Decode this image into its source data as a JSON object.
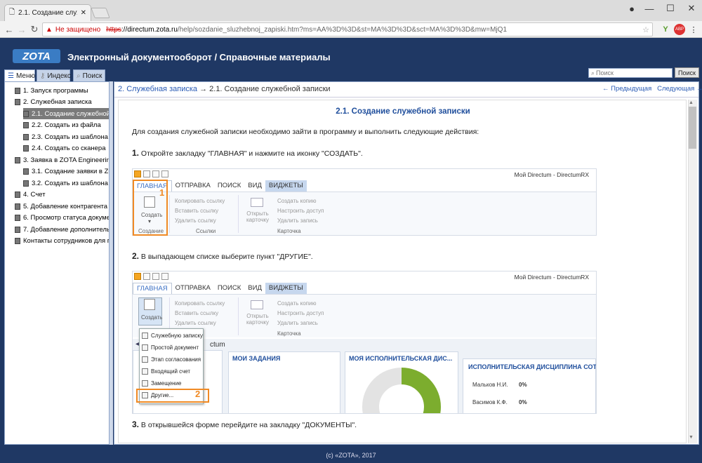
{
  "browser": {
    "tab_title": "2.1. Создание служебно",
    "not_secure": "Не защищено",
    "url_scheme": "https",
    "url_rest": "://directum.zota.ru",
    "url_path": "/help/sozdanie_sluzhebnoj_zapiski.htm?ms=AA%3D%3D&st=MA%3D%3D&sct=MA%3D%3D&mw=MjQ1"
  },
  "site": {
    "logo": "ZOTA",
    "title": "Электронный документооборот / Справочные материалы"
  },
  "left_tabs": [
    {
      "label": "Меню",
      "icon": "list-icon"
    },
    {
      "label": "Индекс",
      "icon": "key-icon"
    },
    {
      "label": "Поиск",
      "icon": "search-icon"
    }
  ],
  "search": {
    "placeholder": "Поиск",
    "button": "Поиск"
  },
  "tree": [
    {
      "label": "1. Запуск программы",
      "level": 0
    },
    {
      "label": "2. Служебная записка",
      "level": 0
    },
    {
      "label": "2.1. Создание служебной за",
      "level": 1,
      "selected": true
    },
    {
      "label": "2.2. Создать из файла",
      "level": 1
    },
    {
      "label": "2.3. Создать из шаблона",
      "level": 1
    },
    {
      "label": "2.4. Создать со сканера",
      "level": 1
    },
    {
      "label": "3. Заявка в ZOTA Engineering",
      "level": 0
    },
    {
      "label": "3.1. Создание заявки в ZOT",
      "level": 1
    },
    {
      "label": "3.2. Создать из шаблона",
      "level": 1
    },
    {
      "label": "4. Счет",
      "level": 0
    },
    {
      "label": "5. Добавление контрагента",
      "level": 0
    },
    {
      "label": "6. Просмотр статуса документа",
      "level": 0
    },
    {
      "label": "7. Добавление дополнительны",
      "level": 0
    },
    {
      "label": "Контакты сотрудников для пом",
      "level": 0
    }
  ],
  "breadcrumb": {
    "parent": "2. Служебная записка",
    "sep": "→",
    "current": "2.1. Создание служебной записки"
  },
  "pager": {
    "prev": "← Предыдущая",
    "next": "Следующая →"
  },
  "doc": {
    "title": "2.1. Создание служебной записки",
    "intro": "Для создания служебной записки необходимо зайти в программу и выполнить следующие действия:",
    "steps": [
      {
        "num": "1.",
        "text": " Откройте закладку \"ГЛАВНАЯ\" и нажмите на иконку \"СОЗДАТЬ\"."
      },
      {
        "num": "2.",
        "text": " В выпадающем списке выберите пункт \"ДРУГИЕ\"."
      },
      {
        "num": "3.",
        "text": " В открывшейся форме перейдите на закладку \"ДОКУМЕНТЫ\"."
      }
    ]
  },
  "ribbon": {
    "app_title": "Мой Directum - DirectumRX",
    "tabs": [
      "ГЛАВНАЯ",
      "ОТПРАВКА",
      "ПОИСК",
      "ВИД",
      "ВИДЖЕТЫ"
    ],
    "create": "Создать",
    "group_create": "Создание",
    "links": [
      "Копировать ссылку",
      "Вставить ссылку",
      "Удалить ссылку"
    ],
    "group_links": "Ссылки",
    "open_card": "Открыть карточку",
    "card_items": [
      "Создать копию",
      "Настроить доступ",
      "Удалить запись"
    ],
    "group_card": "Карточка",
    "markers": [
      "1",
      "2"
    ]
  },
  "dropdown": [
    "Служебную записку",
    "Простой документ",
    "Этап согласования",
    "Входящий счет",
    "Замещение",
    "Другие..."
  ],
  "dashboard": {
    "crumb": "ctum",
    "my_tasks": "МОИ ЗАДАНИЯ",
    "my_discipline": "МОЯ ИСПОЛНИТЕЛЬСКАЯ ДИС...",
    "discipline": "ИСПОЛНИТЕЛЬСКАЯ ДИСЦИПЛИНА СОТР",
    "rows": [
      {
        "name": "Мальков Н.И.",
        "value": "0%"
      },
      {
        "name": "Васимов К.Ф.",
        "value": "0%"
      }
    ],
    "donut_fill": 0.62
  },
  "footer": "(c) «ZOTA», 2017",
  "colors": {
    "header": "#1f3864",
    "accent": "#f08a24",
    "donut": "#7cad2e",
    "link": "#2a5bb5"
  }
}
